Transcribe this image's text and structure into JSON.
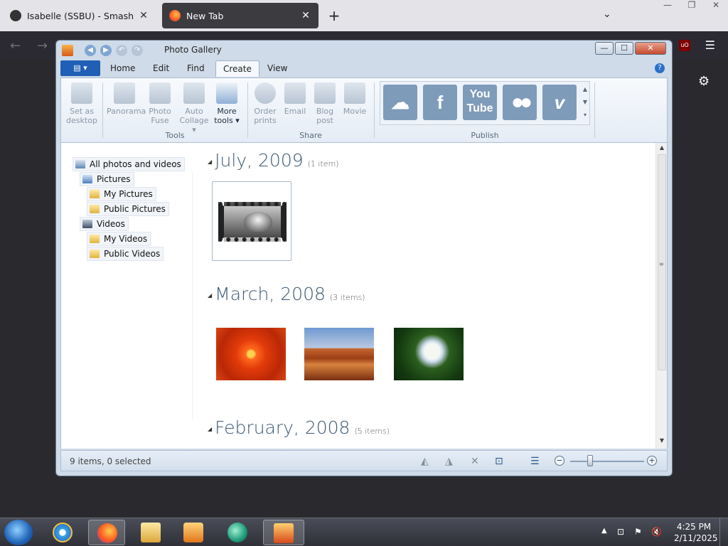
{
  "browser": {
    "tabs": [
      {
        "title": "Isabelle (SSBU) - SmashWiki, the",
        "close": "✕"
      },
      {
        "title": "New Tab",
        "close": "✕"
      }
    ],
    "new_tab_symbol": "+",
    "tab_list_symbol": "⌄",
    "window_controls": [
      "—",
      "❐",
      "✕"
    ],
    "back_symbol": "←",
    "forward_symbol": "→",
    "menu_symbol": "☰",
    "extension_badge": "uO",
    "settings_symbol": "⚙"
  },
  "gallery": {
    "window_title": "Photo Gallery",
    "window_controls": {
      "minimize": "—",
      "maximize": "☐",
      "close": "✕"
    },
    "file_button": "▤ ▾",
    "tabs": [
      "Home",
      "Edit",
      "Find",
      "Create",
      "View"
    ],
    "active_tab": "Create",
    "help_symbol": "?",
    "ribbon": {
      "buttons": [
        {
          "label1": "Set as",
          "label2": "desktop"
        },
        {
          "label1": "Panorama",
          "label2": ""
        },
        {
          "label1": "Photo",
          "label2": "Fuse"
        },
        {
          "label1": "Auto",
          "label2": "Collage ▾"
        },
        {
          "label1": "More",
          "label2": "tools ▾"
        },
        {
          "label1": "Order",
          "label2": "prints"
        },
        {
          "label1": "Email",
          "label2": ""
        },
        {
          "label1": "Blog",
          "label2": "post"
        },
        {
          "label1": "Movie",
          "label2": ""
        }
      ],
      "groups": [
        "Tools",
        "Share",
        "Publish"
      ],
      "publish_services": [
        "☁",
        "f",
        "You Tube",
        "●●",
        "v"
      ]
    },
    "tree": [
      {
        "label": "All photos and videos",
        "icon": "library-icon"
      },
      {
        "label": "Pictures",
        "icon": "pictures-icon"
      },
      {
        "label": "My Pictures",
        "icon": "folder-icon"
      },
      {
        "label": "Public Pictures",
        "icon": "folder-icon"
      },
      {
        "label": "Videos",
        "icon": "videos-icon"
      },
      {
        "label": "My Videos",
        "icon": "folder-icon"
      },
      {
        "label": "Public Videos",
        "icon": "folder-icon"
      }
    ],
    "groups": [
      {
        "title": "July, 2009",
        "count": "(1 item)"
      },
      {
        "title": "March, 2008",
        "count": "(3 items)"
      },
      {
        "title": "February, 2008",
        "count": "(5 items)"
      }
    ],
    "status": "9 items, 0 selected",
    "status_icons": [
      "◭",
      "◮",
      "✕",
      "⊡",
      "☰"
    ],
    "zoom_out": "−",
    "zoom_in": "+",
    "scroll_up": "▲",
    "scroll_down": "▼",
    "scroll_grip": "≡"
  },
  "taskbar": {
    "tray_expand": "▲",
    "tray_icons": [
      "⊡",
      "⚑",
      "🔇"
    ],
    "time": "4:25 PM",
    "date": "2/11/2025"
  }
}
